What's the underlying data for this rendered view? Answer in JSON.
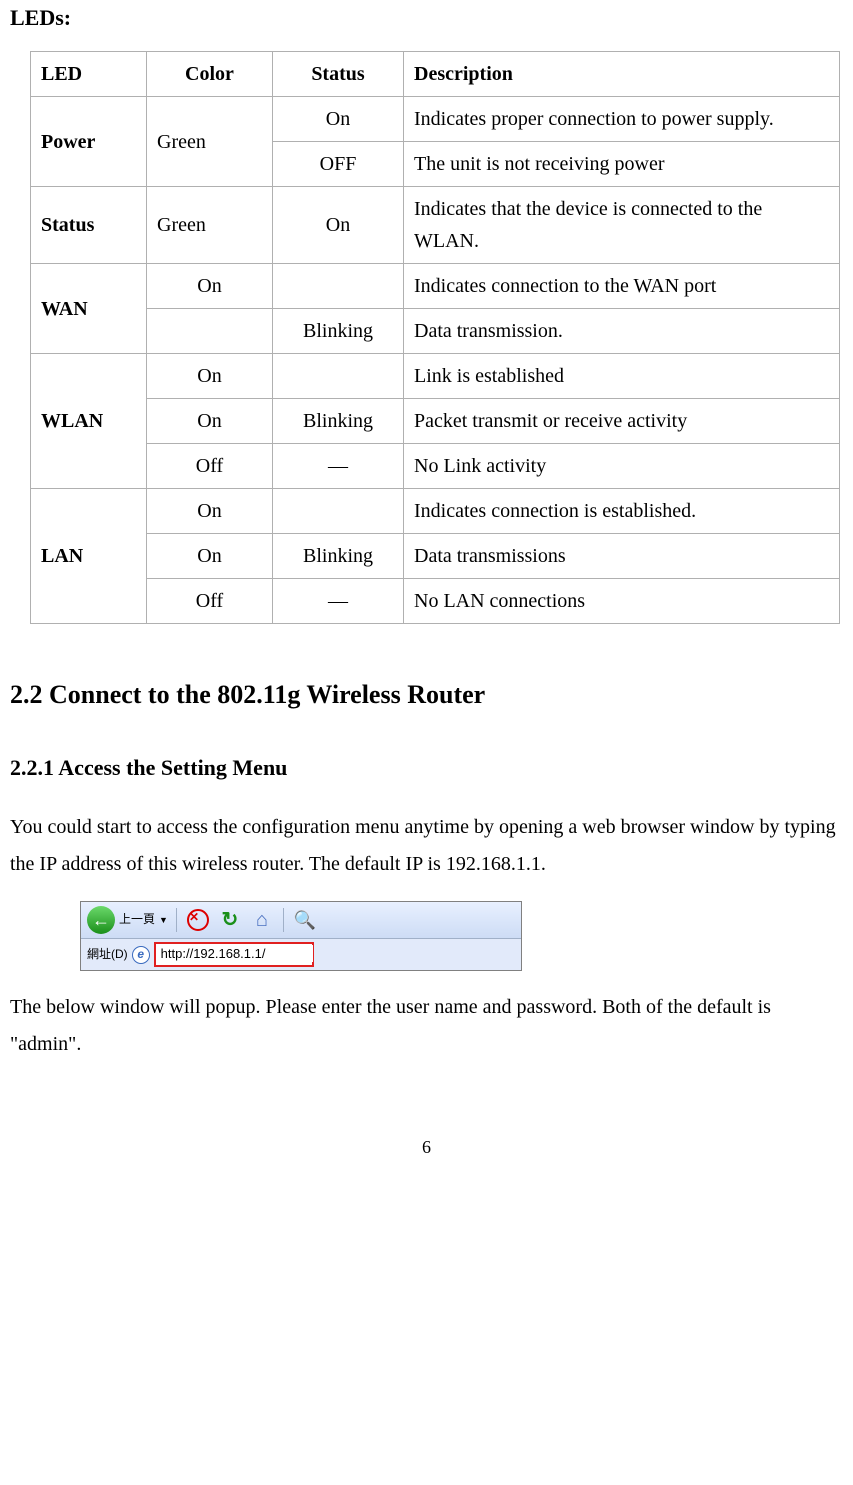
{
  "heading_leds": "LEDs:",
  "table": {
    "headers": {
      "led": "LED",
      "color": "Color",
      "status": "Status",
      "description": "Description"
    },
    "power": {
      "label": "Power",
      "color": "Green",
      "rows": [
        {
          "status": "On",
          "desc": "Indicates proper connection to power supply."
        },
        {
          "status": "OFF",
          "desc": "The unit is not receiving power"
        }
      ]
    },
    "status_row": {
      "label": "Status",
      "color": "Green",
      "status": "On",
      "desc": "Indicates that the device is connected to the WLAN."
    },
    "wan": {
      "label": "WAN",
      "rows": [
        {
          "color": "On",
          "status": "",
          "desc": "Indicates connection to the WAN port"
        },
        {
          "color": "",
          "status": "Blinking",
          "desc": "Data transmission."
        }
      ]
    },
    "wlan": {
      "label": "WLAN",
      "rows": [
        {
          "color": "On",
          "status": "",
          "desc": "Link is established"
        },
        {
          "color": "On",
          "status": "Blinking",
          "desc": "Packet transmit or receive activity"
        },
        {
          "color": "Off",
          "status": "—",
          "desc": "No Link activity"
        }
      ]
    },
    "lan": {
      "label": "LAN",
      "rows": [
        {
          "color": "On",
          "status": "",
          "desc": "Indicates connection is established."
        },
        {
          "color": "On",
          "status": "Blinking",
          "desc": "Data transmissions"
        },
        {
          "color": "Off",
          "status": "—",
          "desc": "No LAN connections"
        }
      ]
    }
  },
  "section_2_2": "2.2 Connect to the 802.11g Wireless Router",
  "section_2_2_1": "2.2.1    Access the Setting Menu",
  "para1": "You could start to access the configuration menu anytime by opening a web browser window by typing the IP address of this wireless router.    The default IP is 192.168.1.1.",
  "browser": {
    "back_label": "上一頁",
    "back_arrow": "←",
    "dropdown": "▼",
    "address_label": "網址(D)",
    "url": "http://192.168.1.1/"
  },
  "para2": "The below window will popup.    Please enter the user name and password.    Both of the default is \"admin\".",
  "page_number": "6"
}
